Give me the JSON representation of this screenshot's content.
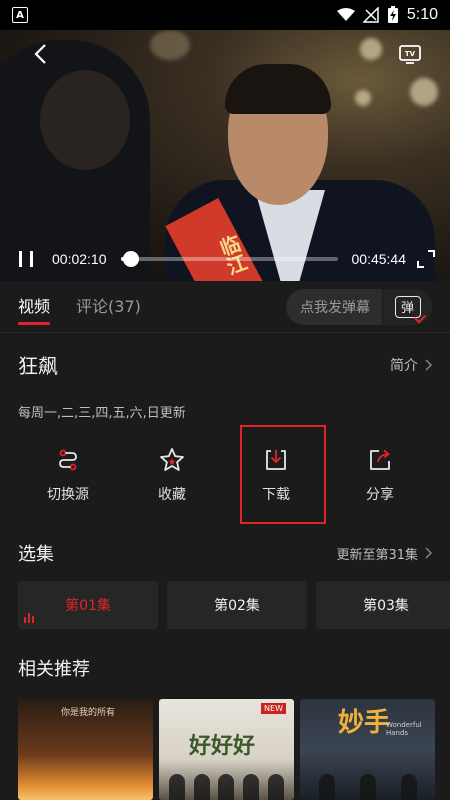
{
  "status_bar": {
    "time": "5:10"
  },
  "player": {
    "current_time": "00:02:10",
    "duration": "00:45:44",
    "progress": 0.047,
    "sash_text": "临江"
  },
  "tabs": [
    {
      "label": "视频",
      "active": true
    },
    {
      "label": "评论(37)",
      "active": false
    }
  ],
  "danmaku": {
    "placeholder": "点我发弹幕",
    "button_label": "弹"
  },
  "show": {
    "title": "狂飙",
    "intro_label": "简介",
    "schedule": "每周一,二,三,四,五,六,日更新"
  },
  "actions": [
    {
      "label": "切换源",
      "icon": "switch-source-icon"
    },
    {
      "label": "收藏",
      "icon": "star-icon"
    },
    {
      "label": "下载",
      "icon": "download-icon"
    },
    {
      "label": "分享",
      "icon": "share-icon"
    }
  ],
  "episodes": {
    "section_title": "选集",
    "update_text": "更新至第31集",
    "items": [
      {
        "label": "第01集",
        "active": true
      },
      {
        "label": "第02集",
        "active": false
      },
      {
        "label": "第03集",
        "active": false
      }
    ]
  },
  "recommend": {
    "section_title": "相关推荐",
    "posters": [
      {
        "text": "你是我的所有"
      },
      {
        "text": "好好好",
        "badge": "NEW"
      },
      {
        "text": "妙手",
        "sub": "Wonderful Hands"
      }
    ]
  },
  "colors": {
    "accent": "#e0242c",
    "background": "#1b1b1b",
    "chip": "#262626"
  }
}
